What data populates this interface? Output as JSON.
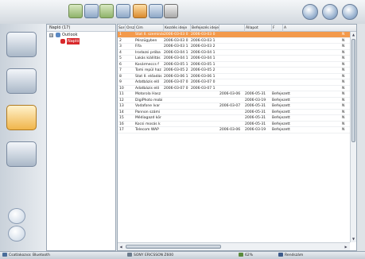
{
  "toolbar": {
    "left_icons": [
      "sync-icon",
      "contacts-icon",
      "send-icon",
      "messages-icon",
      "import-icon",
      "search-icon",
      "print-icon"
    ],
    "right_icons": [
      "clock-icon",
      "settings-icon",
      "help-icon"
    ]
  },
  "sidebar": {
    "items": [
      "contacts-book-icon",
      "phone-sync-icon",
      "messages-icon",
      "notes-icon"
    ],
    "bottom": [
      "connect-icon",
      "disconnect-icon"
    ]
  },
  "tree": {
    "header": "Napló (17)",
    "nodes": [
      {
        "label": "Outlook",
        "expander": "⊟"
      },
      {
        "label": "Napló"
      }
    ]
  },
  "grid": {
    "columns": [
      "Sors",
      "Orsz",
      "Cím",
      "Kezdés ideje",
      "Befejezés ideje",
      "Állapot",
      "F",
      "A"
    ],
    "rows": [
      {
        "n": "1",
        "title": "Stat II. szeminár",
        "start": "2006-03-03 0",
        "end": "2006-03-03 0",
        "d1": "",
        "d2": "",
        "status": "",
        "p": "N"
      },
      {
        "n": "2",
        "title": "Pénzügyben",
        "start": "2006-03-03 0",
        "end": "2006-03-03 1",
        "d1": "",
        "d2": "",
        "status": "",
        "p": "N"
      },
      {
        "n": "3",
        "title": "Fifa",
        "start": "2006-03-03 1",
        "end": "2006-03-03 2",
        "d1": "",
        "d2": "",
        "status": "",
        "p": "N"
      },
      {
        "n": "4",
        "title": "Irodazsi próba",
        "start": "2006-03-04 1",
        "end": "2006-03-04 1",
        "d1": "",
        "d2": "",
        "status": "",
        "p": "N"
      },
      {
        "n": "5",
        "title": "Lakás kiállítás",
        "start": "2006-03-04 1",
        "end": "2006-03-04 1",
        "d1": "",
        "d2": "",
        "status": "",
        "p": "N"
      },
      {
        "n": "6",
        "title": "Kosármeccs f",
        "start": "2006-03-05 1",
        "end": "2006-03-05 1",
        "d1": "",
        "d2": "",
        "status": "",
        "p": "N"
      },
      {
        "n": "7",
        "title": "Tomi repül haz",
        "start": "2006-03-05 2",
        "end": "2006-03-05 2",
        "d1": "",
        "d2": "",
        "status": "",
        "p": "N"
      },
      {
        "n": "8",
        "title": "Stat II. előadás",
        "start": "2006-03-06 1",
        "end": "2006-03-06 1",
        "d1": "",
        "d2": "",
        "status": "",
        "p": "N"
      },
      {
        "n": "9",
        "title": "Adatbázis elő",
        "start": "2006-03-07 0",
        "end": "2006-03-07 0",
        "d1": "",
        "d2": "",
        "status": "",
        "p": "N"
      },
      {
        "n": "10",
        "title": "Adatbázis elő",
        "start": "2006-03-07 0",
        "end": "2006-03-07 1",
        "d1": "",
        "d2": "",
        "status": "",
        "p": "N"
      },
      {
        "n": "11",
        "title": "Motorola Hasz",
        "start": "",
        "end": "",
        "d1": "2006-03-06",
        "d2": "2006-05-31",
        "status": "Befejezett",
        "p": "N"
      },
      {
        "n": "12",
        "title": "DigiPhoto mobi",
        "start": "",
        "end": "",
        "d1": "",
        "d2": "2006-03-19",
        "status": "Befejezett",
        "p": "N"
      },
      {
        "n": "13",
        "title": "Vodafone Ivar",
        "start": "",
        "end": "",
        "d1": "2006-03-07",
        "d2": "2006-05-31",
        "status": "Befejezett",
        "p": "N"
      },
      {
        "n": "14",
        "title": "Pannon számi",
        "start": "",
        "end": "",
        "d1": "",
        "d2": "2006-05-31",
        "status": "Befejezett",
        "p": "N"
      },
      {
        "n": "15",
        "title": "Médiagazd kör",
        "start": "",
        "end": "",
        "d1": "",
        "d2": "2006-05-31",
        "status": "Befejezett",
        "p": "N"
      },
      {
        "n": "16",
        "title": "Kocsi mosás k",
        "start": "",
        "end": "",
        "d1": "",
        "d2": "2006-05-31",
        "status": "Befejezett",
        "p": "N"
      },
      {
        "n": "17",
        "title": "Telecom WAP",
        "start": "",
        "end": "",
        "d1": "2006-03-06",
        "d2": "2006-03-19",
        "status": "Befejezett",
        "p": "N"
      }
    ],
    "selected_row": 0
  },
  "statusbar": {
    "connection": "Csatlakozva: Bluetooth",
    "device": "SONY ERICSSON Z600",
    "battery": "62%",
    "signal": "Rendszám"
  },
  "colors": {
    "accent": "#f39a4c",
    "tree_selected": "#d8282b"
  }
}
